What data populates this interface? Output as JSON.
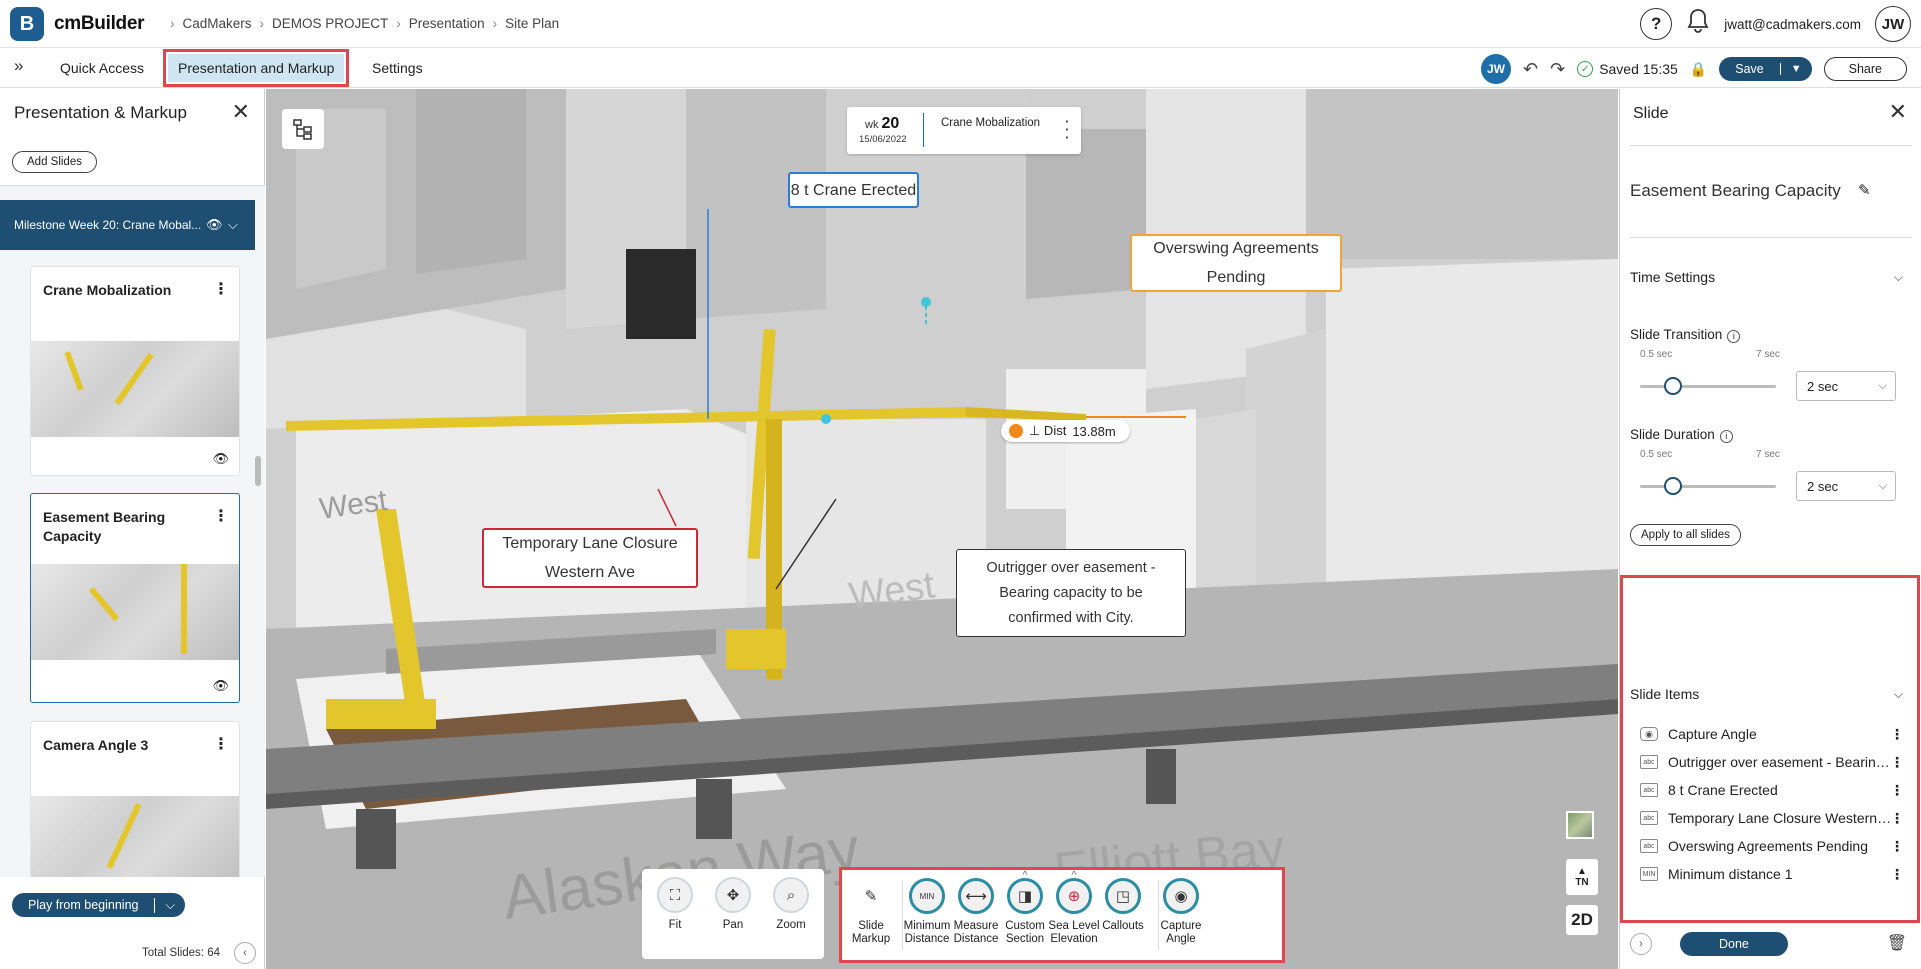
{
  "app": {
    "logo_letter": "B",
    "name": "cmBuilder"
  },
  "breadcrumb": [
    "CadMakers",
    "DEMOS PROJECT",
    "Presentation",
    "Site Plan"
  ],
  "header": {
    "help": "?",
    "bell": "🔔",
    "email": "jwatt@cadmakers.com",
    "avatar": "JW"
  },
  "menubar": {
    "collapse": "»",
    "tabs": [
      "Quick Access",
      "Presentation and Markup",
      "Settings"
    ],
    "avatar": "JW",
    "undo": "↶",
    "redo": "↷",
    "saved": "Saved 15:35",
    "lock": "🔒",
    "save": "Save",
    "share": "Share"
  },
  "left": {
    "title": "Presentation & Markup",
    "close": "✕",
    "add_slides": "Add Slides",
    "milestone": "Milestone Week 20: Crane Mobal...",
    "slides": [
      {
        "title": "Crane Mobalization"
      },
      {
        "title": "Easement Bearing Capacity"
      },
      {
        "title": "Camera Angle 3"
      }
    ],
    "play": "Play from beginning",
    "total": "Total Slides: 64"
  },
  "viewport": {
    "timeline": {
      "wk_label": "wk",
      "wk_num": "20",
      "date": "15/06/2022",
      "name": "Crane Mobalization"
    },
    "callouts": {
      "crane": "8 t Crane Erected",
      "overswing": "Overswing Agreements Pending",
      "lane": "Temporary Lane Closure Western Ave",
      "outrigger": "Outrigger over easement - Bearing capacity to be confirmed with City."
    },
    "dist": {
      "label": "⊥ Dist",
      "value": "13.88m"
    },
    "street_labels": [
      "Alaskan Way",
      "Elliott Bay",
      "West",
      "West"
    ],
    "compass": {
      "arrow": "▲",
      "label": "TN"
    },
    "view_mode": "2D",
    "nav_tools": [
      "Fit",
      "Pan",
      "Zoom"
    ],
    "tools": [
      "Slide Markup",
      "Minimum Distance",
      "Measure Distance",
      "Custom Section",
      "Sea Level Elevation",
      "Callouts",
      "Capture Angle"
    ]
  },
  "right": {
    "title": "Slide",
    "close": "✕",
    "slide_name": "Easement Bearing Capacity",
    "time_settings": "Time Settings",
    "transition": {
      "label": "Slide Transition",
      "min": "0.5 sec",
      "max": "7 sec",
      "value": "2 sec",
      "level": 0.2
    },
    "duration": {
      "label": "Slide Duration",
      "min": "0.5 sec",
      "max": "7 sec",
      "value": "2 sec",
      "level": 0.2
    },
    "apply_all": "Apply to all slides",
    "items_title": "Slide Items",
    "items": [
      {
        "icon": "camera-icon",
        "label": "Capture Angle"
      },
      {
        "icon": "callout-icon",
        "label": "Outrigger over easement - Bearing capacity to be confirmed with City."
      },
      {
        "icon": "callout-icon",
        "label": "8 t Crane Erected"
      },
      {
        "icon": "callout-icon",
        "label": "Temporary Lane Closure Western Ave"
      },
      {
        "icon": "callout-icon",
        "label": "Overswing Agreements Pending"
      },
      {
        "icon": "min-distance-icon",
        "label": "Minimum distance 1"
      }
    ],
    "done": "Done"
  }
}
